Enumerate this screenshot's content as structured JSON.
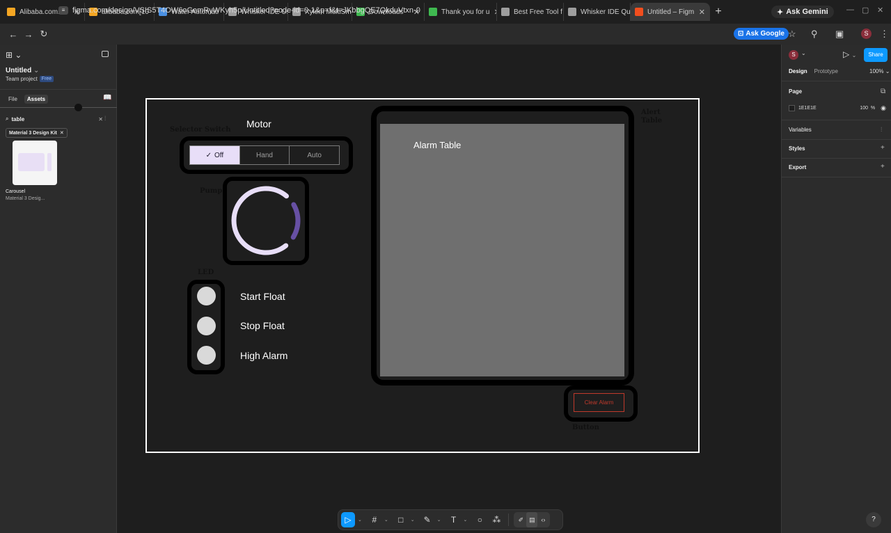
{
  "browser": {
    "tabs": [
      {
        "label": "Alibaba.com: M",
        "color": "#f5a623"
      },
      {
        "label": "alibaba.com[10",
        "color": "#f5a623"
      },
      {
        "label": "Water Automati",
        "color": "#4a90e2"
      },
      {
        "label": "Whisker IDE Us",
        "color": "#9e9e9e"
      },
      {
        "label": "Xylem MultiSm",
        "color": "#9e9e9e"
      },
      {
        "label": "Downloads",
        "color": "#3fb950"
      },
      {
        "label": "Thank you for u",
        "color": "#3fb950"
      },
      {
        "label": "Best Free Tool f",
        "color": "#9e9e9e"
      },
      {
        "label": "Whisker IDE Qu",
        "color": "#9e9e9e"
      },
      {
        "label": "Untitled – Figm",
        "color": "#f24e1e"
      }
    ],
    "new_tab": "+",
    "gemini": "Ask Gemini",
    "url": "figma.com/design/VSIS5T4OW6oGemRyWKyh5p/Untitled?node-id=0-1&p=f&t=JKbbgQE7QkduVtxn-0",
    "ask_google": "Ask Google",
    "profile_initial": "S"
  },
  "left_panel": {
    "file_title": "Untitled",
    "team": "Team project",
    "plan_badge": "Free",
    "tabs": [
      "File",
      "Assets"
    ],
    "search_value": "table",
    "chip": "Material 3 Design Kit",
    "asset_name": "Carousel",
    "asset_sub": "Material 3 Desig..."
  },
  "right_panel": {
    "avatar": "S",
    "share": "Share",
    "tabs": [
      "Design",
      "Prototype"
    ],
    "zoom": "100%",
    "page_label": "Page",
    "page_color": "1E1E1E",
    "page_opacity": "100",
    "page_opacity_unit": "%",
    "variables": "Variables",
    "styles": "Styles",
    "export": "Export",
    "help": "?"
  },
  "canvas": {
    "selector_switch_label": "Selector Switch",
    "motor_label": "Motor",
    "segments": [
      "Off",
      "Hand",
      "Auto"
    ],
    "pump_label": "Pump",
    "pump_progress": 0.32,
    "led_label": "LED",
    "led_items": [
      "Start Float",
      "Stop Float",
      "High Alarm"
    ],
    "alert_table_label_1": "Alert",
    "alert_table_label_2": "Table",
    "alarm_table_title": "Alarm Table",
    "clear_alarm": "Clear Alarm",
    "button_label": "Button"
  },
  "colors": {
    "accent": "#0d99ff",
    "segment_active": "#e8def8",
    "pump_track": "#e8def8",
    "pump_indicator": "#6750a4",
    "alarm_panel": "#6f6f6f",
    "clear_button": "#c0392b"
  }
}
